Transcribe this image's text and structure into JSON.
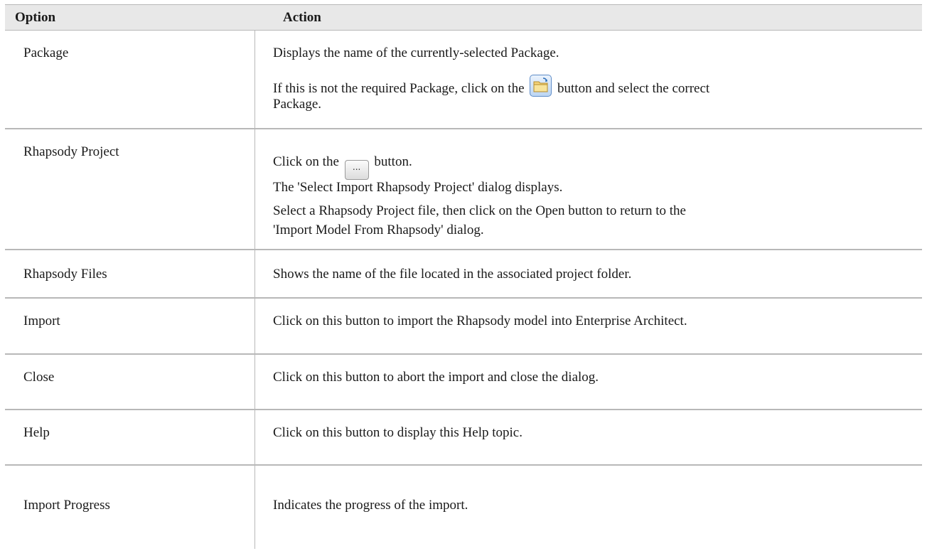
{
  "header": {
    "option": "Option",
    "action": "Action"
  },
  "rows": [
    {
      "option": "Package",
      "lines": [
        "Displays the name of the currently-selected Package.",
        "If this is not the required Package, click on the",
        "button and select the correct",
        "Package."
      ],
      "icon": "folder-browse-icon"
    },
    {
      "option": "Rhapsody Project",
      "lines": [
        "Click on the",
        "button.",
        "The 'Select Import Rhapsody Project' dialog displays.",
        "Select a Rhapsody Project file, then click on the Open button to return to the",
        "'Import Model From Rhapsody' dialog."
      ],
      "icon": "ellipsis-button-icon",
      "icon_label": "..."
    },
    {
      "option": "Rhapsody Files",
      "action": "Shows the name of the file located in the associated project folder."
    },
    {
      "option": "Import",
      "action": "Click on this button to import the Rhapsody model into Enterprise Architect."
    },
    {
      "option": "Close",
      "action": "Click on this button to abort the import and close the dialog."
    },
    {
      "option": "Help",
      "action": "Click on this button to display this Help topic."
    },
    {
      "option": "Import Progress",
      "action": "Indicates the progress of the import."
    }
  ]
}
